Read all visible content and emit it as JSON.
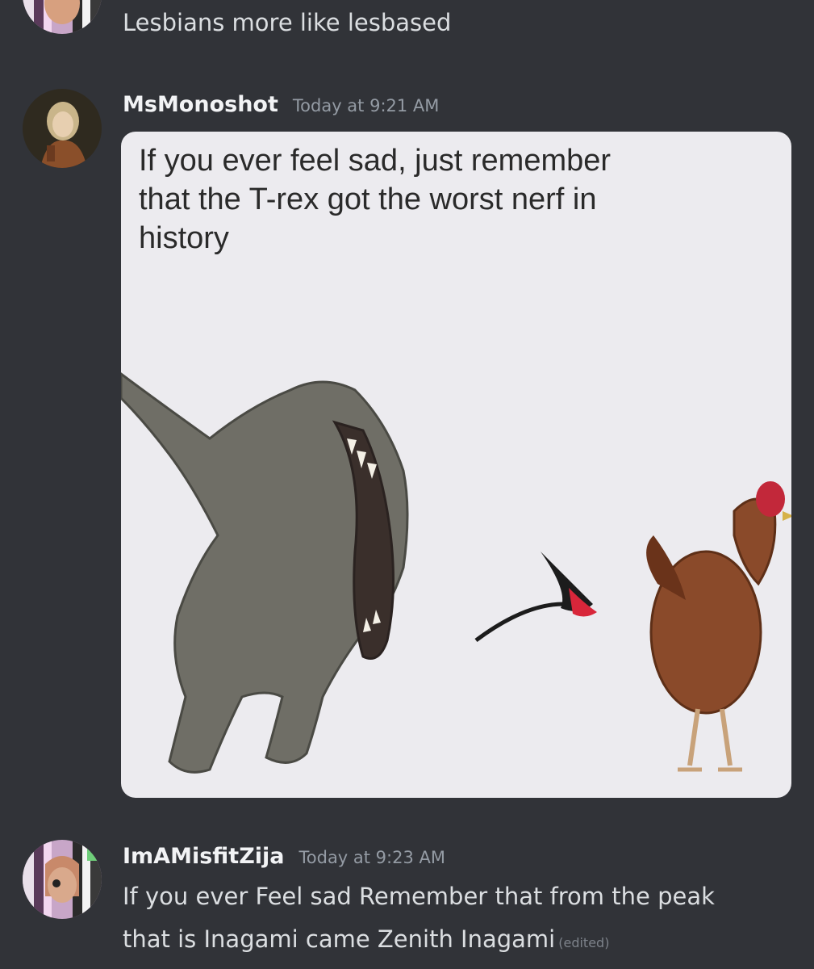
{
  "messages": [
    {
      "text": "Lesbians more like lesbased"
    },
    {
      "username": "MsMonoshot",
      "timestamp": "Today at 9:21 AM",
      "attachment": {
        "caption": "If you ever feel sad, just remember\nthat the T-rex got the worst nerf in\nhistory"
      }
    },
    {
      "username": "ImAMisfitZija",
      "timestamp": "Today at 9:23 AM",
      "text_line1": "If you ever Feel sad Remember that from the peak",
      "text_line2": "that is Inagami came Zenith Inagami",
      "edited": "(edited)"
    }
  ],
  "colors": {
    "background": "#313338",
    "username": "#f2f3f5",
    "timestamp": "#949ba4",
    "text": "#dbdee1"
  }
}
